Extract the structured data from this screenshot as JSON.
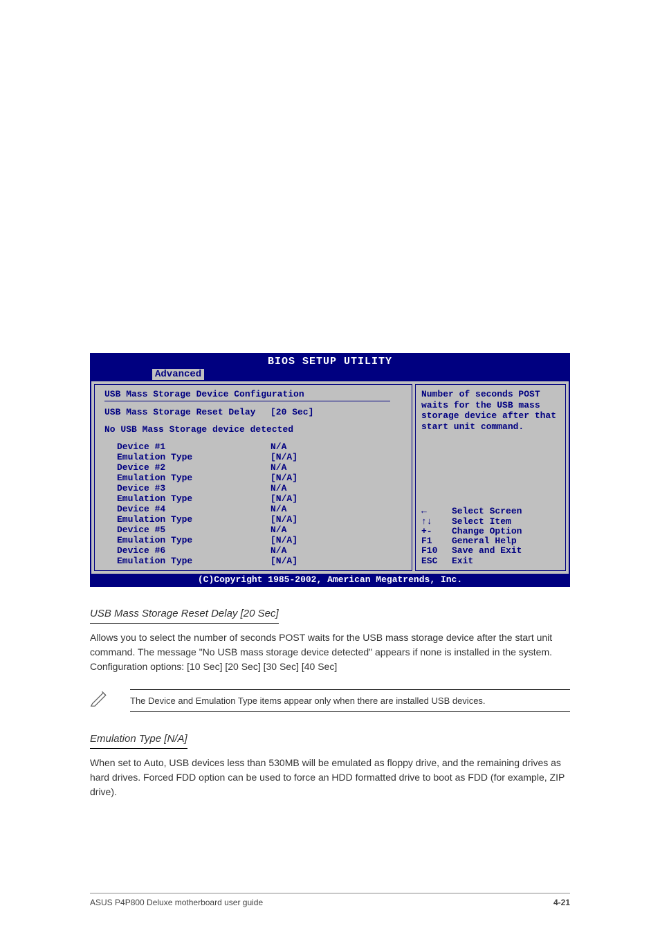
{
  "bios": {
    "title": "BIOS SETUP UTILITY",
    "active_tab": "Advanced",
    "left": {
      "section_title": "USB Mass Storage Device Configuration",
      "reset_delay_label": "USB Mass Storage Reset Delay",
      "reset_delay_value": "[20 Sec]",
      "no_device_msg": "No USB Mass Storage device detected",
      "devices": [
        {
          "label": "Device #1",
          "value": "N/A",
          "emu_label": "Emulation Type",
          "emu_value": "[N/A]"
        },
        {
          "label": "Device #2",
          "value": "N/A",
          "emu_label": "Emulation Type",
          "emu_value": "[N/A]"
        },
        {
          "label": "Device #3",
          "value": "N/A",
          "emu_label": "Emulation Type",
          "emu_value": "[N/A]"
        },
        {
          "label": "Device #4",
          "value": "N/A",
          "emu_label": "Emulation Type",
          "emu_value": "[N/A]"
        },
        {
          "label": "Device #5",
          "value": "N/A",
          "emu_label": "Emulation Type",
          "emu_value": "[N/A]"
        },
        {
          "label": "Device #6",
          "value": "N/A",
          "emu_label": "Emulation Type",
          "emu_value": "[N/A]"
        }
      ]
    },
    "help": {
      "text": "Number of seconds POST waits for the USB mass storage device after that start unit command."
    },
    "nav": [
      {
        "key": "←",
        "action": "Select Screen"
      },
      {
        "key": "↑↓",
        "action": "Select Item"
      },
      {
        "key": "+-",
        "action": "Change Option"
      },
      {
        "key": "F1",
        "action": "General Help"
      },
      {
        "key": "F10",
        "action": "Save and Exit"
      },
      {
        "key": "ESC",
        "action": "Exit"
      }
    ],
    "copyright": "(C)Copyright 1985-2002, American Megatrends, Inc."
  },
  "doc": {
    "h1": "USB Mass Storage Reset Delay [20 Sec]",
    "p1": "Allows you to select the number of seconds POST waits for the USB mass storage device after the start unit command. The message \"No USB mass storage device detected\" appears if none is installed in the system. Configuration options: [10 Sec] [20 Sec] [30 Sec] [40 Sec]",
    "note": "The Device and Emulation Type items appear only when there are installed USB devices.",
    "h2": "Emulation Type [N/A]",
    "p2": "When set to Auto, USB devices less than 530MB will be emulated as floppy drive, and the remaining drives as hard drives. Forced FDD option can be used to force an HDD formatted drive to boot as FDD (for example, ZIP drive).",
    "footer_left": "ASUS P4P800 Deluxe motherboard user guide",
    "footer_right": "4-21"
  }
}
